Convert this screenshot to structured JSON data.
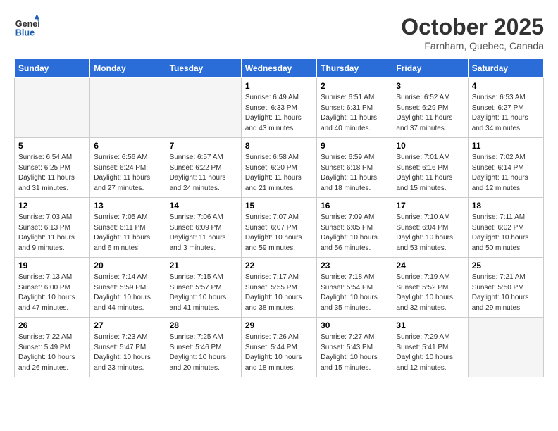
{
  "header": {
    "logo_line1": "General",
    "logo_line2": "Blue",
    "month_title": "October 2025",
    "subtitle": "Farnham, Quebec, Canada"
  },
  "days_of_week": [
    "Sunday",
    "Monday",
    "Tuesday",
    "Wednesday",
    "Thursday",
    "Friday",
    "Saturday"
  ],
  "weeks": [
    [
      {
        "day": "",
        "empty": true
      },
      {
        "day": "",
        "empty": true
      },
      {
        "day": "",
        "empty": true
      },
      {
        "day": "1",
        "sunrise": "6:49 AM",
        "sunset": "6:33 PM",
        "daylight": "11 hours and 43 minutes."
      },
      {
        "day": "2",
        "sunrise": "6:51 AM",
        "sunset": "6:31 PM",
        "daylight": "11 hours and 40 minutes."
      },
      {
        "day": "3",
        "sunrise": "6:52 AM",
        "sunset": "6:29 PM",
        "daylight": "11 hours and 37 minutes."
      },
      {
        "day": "4",
        "sunrise": "6:53 AM",
        "sunset": "6:27 PM",
        "daylight": "11 hours and 34 minutes."
      }
    ],
    [
      {
        "day": "5",
        "sunrise": "6:54 AM",
        "sunset": "6:25 PM",
        "daylight": "11 hours and 31 minutes."
      },
      {
        "day": "6",
        "sunrise": "6:56 AM",
        "sunset": "6:24 PM",
        "daylight": "11 hours and 27 minutes."
      },
      {
        "day": "7",
        "sunrise": "6:57 AM",
        "sunset": "6:22 PM",
        "daylight": "11 hours and 24 minutes."
      },
      {
        "day": "8",
        "sunrise": "6:58 AM",
        "sunset": "6:20 PM",
        "daylight": "11 hours and 21 minutes."
      },
      {
        "day": "9",
        "sunrise": "6:59 AM",
        "sunset": "6:18 PM",
        "daylight": "11 hours and 18 minutes."
      },
      {
        "day": "10",
        "sunrise": "7:01 AM",
        "sunset": "6:16 PM",
        "daylight": "11 hours and 15 minutes."
      },
      {
        "day": "11",
        "sunrise": "7:02 AM",
        "sunset": "6:14 PM",
        "daylight": "11 hours and 12 minutes."
      }
    ],
    [
      {
        "day": "12",
        "sunrise": "7:03 AM",
        "sunset": "6:13 PM",
        "daylight": "11 hours and 9 minutes."
      },
      {
        "day": "13",
        "sunrise": "7:05 AM",
        "sunset": "6:11 PM",
        "daylight": "11 hours and 6 minutes."
      },
      {
        "day": "14",
        "sunrise": "7:06 AM",
        "sunset": "6:09 PM",
        "daylight": "11 hours and 3 minutes."
      },
      {
        "day": "15",
        "sunrise": "7:07 AM",
        "sunset": "6:07 PM",
        "daylight": "10 hours and 59 minutes."
      },
      {
        "day": "16",
        "sunrise": "7:09 AM",
        "sunset": "6:05 PM",
        "daylight": "10 hours and 56 minutes."
      },
      {
        "day": "17",
        "sunrise": "7:10 AM",
        "sunset": "6:04 PM",
        "daylight": "10 hours and 53 minutes."
      },
      {
        "day": "18",
        "sunrise": "7:11 AM",
        "sunset": "6:02 PM",
        "daylight": "10 hours and 50 minutes."
      }
    ],
    [
      {
        "day": "19",
        "sunrise": "7:13 AM",
        "sunset": "6:00 PM",
        "daylight": "10 hours and 47 minutes."
      },
      {
        "day": "20",
        "sunrise": "7:14 AM",
        "sunset": "5:59 PM",
        "daylight": "10 hours and 44 minutes."
      },
      {
        "day": "21",
        "sunrise": "7:15 AM",
        "sunset": "5:57 PM",
        "daylight": "10 hours and 41 minutes."
      },
      {
        "day": "22",
        "sunrise": "7:17 AM",
        "sunset": "5:55 PM",
        "daylight": "10 hours and 38 minutes."
      },
      {
        "day": "23",
        "sunrise": "7:18 AM",
        "sunset": "5:54 PM",
        "daylight": "10 hours and 35 minutes."
      },
      {
        "day": "24",
        "sunrise": "7:19 AM",
        "sunset": "5:52 PM",
        "daylight": "10 hours and 32 minutes."
      },
      {
        "day": "25",
        "sunrise": "7:21 AM",
        "sunset": "5:50 PM",
        "daylight": "10 hours and 29 minutes."
      }
    ],
    [
      {
        "day": "26",
        "sunrise": "7:22 AM",
        "sunset": "5:49 PM",
        "daylight": "10 hours and 26 minutes."
      },
      {
        "day": "27",
        "sunrise": "7:23 AM",
        "sunset": "5:47 PM",
        "daylight": "10 hours and 23 minutes."
      },
      {
        "day": "28",
        "sunrise": "7:25 AM",
        "sunset": "5:46 PM",
        "daylight": "10 hours and 20 minutes."
      },
      {
        "day": "29",
        "sunrise": "7:26 AM",
        "sunset": "5:44 PM",
        "daylight": "10 hours and 18 minutes."
      },
      {
        "day": "30",
        "sunrise": "7:27 AM",
        "sunset": "5:43 PM",
        "daylight": "10 hours and 15 minutes."
      },
      {
        "day": "31",
        "sunrise": "7:29 AM",
        "sunset": "5:41 PM",
        "daylight": "10 hours and 12 minutes."
      },
      {
        "day": "",
        "empty": true
      }
    ]
  ],
  "labels": {
    "sunrise_label": "Sunrise:",
    "sunset_label": "Sunset:",
    "daylight_label": "Daylight:"
  }
}
